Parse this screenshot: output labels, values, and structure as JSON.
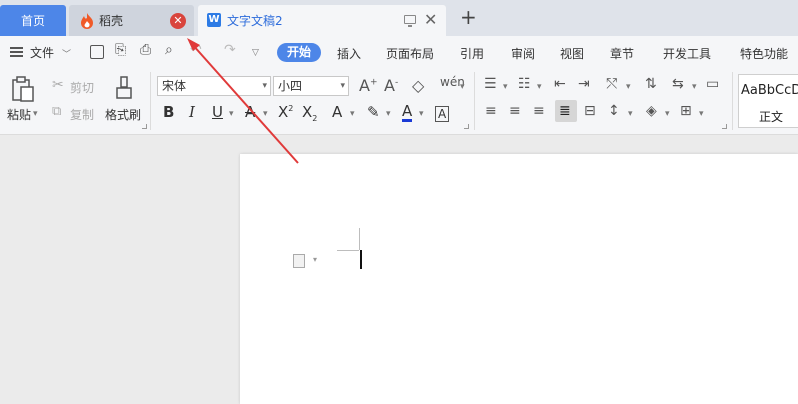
{
  "tabs": {
    "home": "首页",
    "daoke": "稻壳",
    "doc": "文字文稿2",
    "close_glyph": "✕",
    "add_glyph": "+"
  },
  "menu": {
    "file": "文件",
    "start": "开始",
    "items": [
      "插入",
      "页面布局",
      "引用",
      "审阅",
      "视图",
      "章节",
      "开发工具",
      "特色功能"
    ]
  },
  "ribbon": {
    "paste": "粘贴",
    "cut": "剪切",
    "copy": "复制",
    "format_painter": "格式刷",
    "font_name": "宋体",
    "font_size": "小四",
    "style_sample": "AaBbCcD",
    "style_name": "正文"
  },
  "colors": {
    "accent": "#4d86e8",
    "close_red": "#d9453d",
    "arrow_red": "#e03a3a",
    "font_color_bar": "#1a3ad6"
  }
}
